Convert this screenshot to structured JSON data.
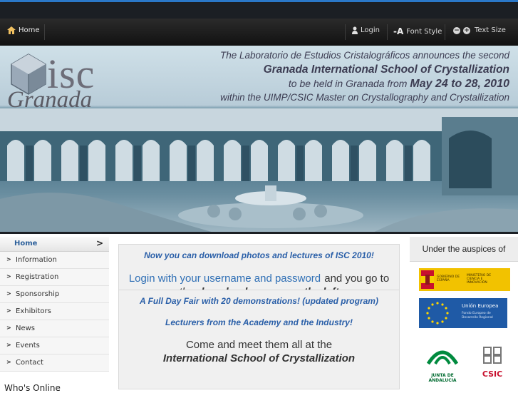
{
  "nav": {
    "home": "Home",
    "login": "Login",
    "font_style": "Font Style",
    "text_size": "Text Size"
  },
  "banner": {
    "logo_text": "isc",
    "logo_sub": "Granada",
    "line1": "The Laboratorio de Estudios Cristalográficos announces the second",
    "line2": "Granada International School of Crystallization",
    "line3_pre": "to be held in Granada from",
    "line3_dates": "May 24 to 28, 2010",
    "line4": "within the UIMP/CSIC Master on Crystallography and Crystallization"
  },
  "sidebar": {
    "home": "Home",
    "chevron": ">",
    "items": [
      {
        "label": "Information"
      },
      {
        "label": "Registration"
      },
      {
        "label": "Sponsorship"
      },
      {
        "label": "Exhibitors"
      },
      {
        "label": "News"
      },
      {
        "label": "Events"
      },
      {
        "label": "Contact"
      }
    ],
    "footer_partial": "Who's Online"
  },
  "main": {
    "box1": {
      "headline": "Now you can download photos and lectures of ISC 2010!",
      "line_a": "Login with your username and password",
      "line_b": "and you go to",
      "line_c": "the",
      "line_d": "downloads menu on the left"
    },
    "box2": {
      "headline": "A Full Day Fair with 20 demonstrations! (updated program)",
      "line2": "Lecturers from the Academy and the Industry!",
      "line3": "Come and meet them all at the",
      "line4": "International School of Crystallization"
    }
  },
  "right": {
    "auspices": "Under the auspices of",
    "logo1": {
      "left": "GOBIERNO DE ESPAÑA",
      "right": "MINISTERIO DE CIENCIA E INNOVACIÓN"
    },
    "logo2": {
      "line1": "Unión Europea",
      "line2": "Fondo Europeo de Desarrollo Regional"
    },
    "logo3": "JUNTA DE ANDALUCIA",
    "logo4": "CSIC"
  },
  "colors": {
    "accent": "#2a78c9",
    "link_blue": "#2f6fb5",
    "nav_bg": "#1b1f24"
  }
}
